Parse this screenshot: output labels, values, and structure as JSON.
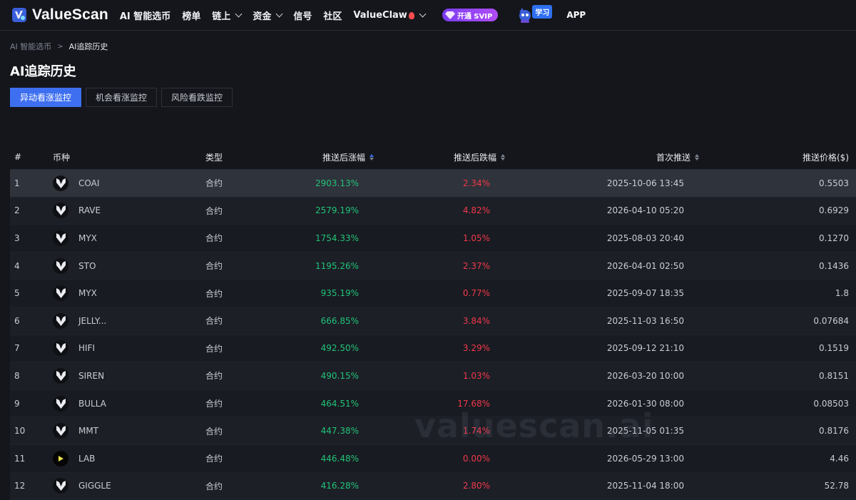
{
  "brand": {
    "name": "ValueScan"
  },
  "nav": {
    "items": [
      {
        "label": "AI 智能选币",
        "dropdown": false
      },
      {
        "label": "榜单",
        "dropdown": false
      },
      {
        "label": "链上",
        "dropdown": true
      },
      {
        "label": "资金",
        "dropdown": true
      },
      {
        "label": "信号",
        "dropdown": false
      },
      {
        "label": "社区",
        "dropdown": false
      },
      {
        "label": "ValueClaw",
        "dropdown": true
      }
    ],
    "svip_label": "开通 SVIP",
    "learn_label": "学习",
    "app_label": "APP"
  },
  "breadcrumb": {
    "parent": "AI 智能选币",
    "current": "AI追踪历史"
  },
  "page_title": "AI追踪历史",
  "tabs": [
    {
      "label": "异动看涨监控",
      "active": true
    },
    {
      "label": "机会看涨监控",
      "active": false
    },
    {
      "label": "风险看跌监控",
      "active": false
    }
  ],
  "table": {
    "headers": {
      "idx": "#",
      "coin": "币种",
      "type": "类型",
      "up": "推送后涨幅",
      "down": "推送后跌幅",
      "first": "首次推送",
      "price": "推送价格($)"
    },
    "rows": [
      {
        "idx": "1",
        "coin": "COAI",
        "type": "合约",
        "up": "2903.13%",
        "down": "2.34%",
        "first": "2025-10-06 13:45",
        "price": "0.5503",
        "icon": "v-shield-icon"
      },
      {
        "idx": "2",
        "coin": "RAVE",
        "type": "合约",
        "up": "2579.19%",
        "down": "4.82%",
        "first": "2026-04-10 05:20",
        "price": "0.6929",
        "icon": "v-shield-icon"
      },
      {
        "idx": "3",
        "coin": "MYX",
        "type": "合约",
        "up": "1754.33%",
        "down": "1.05%",
        "first": "2025-08-03 20:40",
        "price": "0.1270",
        "icon": "v-shield-icon"
      },
      {
        "idx": "4",
        "coin": "STO",
        "type": "合约",
        "up": "1195.26%",
        "down": "2.37%",
        "first": "2026-04-01 02:50",
        "price": "0.1436",
        "icon": "v-shield-icon"
      },
      {
        "idx": "5",
        "coin": "MYX",
        "type": "合约",
        "up": "935.19%",
        "down": "0.77%",
        "first": "2025-09-07 18:35",
        "price": "1.8",
        "icon": "v-shield-icon"
      },
      {
        "idx": "6",
        "coin": "JELLY...",
        "type": "合约",
        "up": "666.85%",
        "down": "3.84%",
        "first": "2025-11-03 16:50",
        "price": "0.07684",
        "icon": "v-shield-icon"
      },
      {
        "idx": "7",
        "coin": "HIFI",
        "type": "合约",
        "up": "492.50%",
        "down": "3.29%",
        "first": "2025-09-12 21:10",
        "price": "0.1519",
        "icon": "v-shield-icon"
      },
      {
        "idx": "8",
        "coin": "SIREN",
        "type": "合约",
        "up": "490.15%",
        "down": "1.03%",
        "first": "2026-03-20 10:00",
        "price": "0.8151",
        "icon": "v-shield-icon"
      },
      {
        "idx": "9",
        "coin": "BULLA",
        "type": "合约",
        "up": "464.51%",
        "down": "17.68%",
        "first": "2026-01-30 08:00",
        "price": "0.08503",
        "icon": "v-shield-icon"
      },
      {
        "idx": "10",
        "coin": "MMT",
        "type": "合约",
        "up": "447.38%",
        "down": "1.74%",
        "first": "2025-11-05 01:35",
        "price": "0.8176",
        "icon": "v-shield-icon"
      },
      {
        "idx": "11",
        "coin": "LAB",
        "type": "合约",
        "up": "446.48%",
        "down": "0.00%",
        "first": "2026-05-29 13:00",
        "price": "4.46",
        "icon": "lab-token-icon"
      },
      {
        "idx": "12",
        "coin": "GIGGLE",
        "type": "合约",
        "up": "416.28%",
        "down": "2.80%",
        "first": "2025-11-04 18:00",
        "price": "52.78",
        "icon": "v-shield-icon"
      }
    ]
  },
  "watermark": "valuescan.ai",
  "colors": {
    "accent": "#3d6ff0",
    "positive": "#22c37a",
    "negative": "#f0384b",
    "background": "#14161c"
  }
}
